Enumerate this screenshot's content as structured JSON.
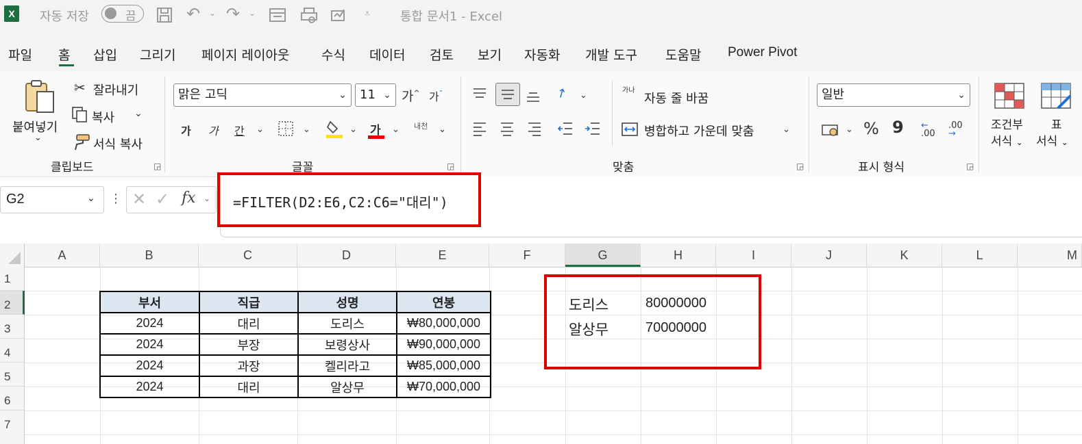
{
  "app": {
    "logo": "X",
    "autosave_label": "자동 저장",
    "autosave_state": "끔",
    "document_title": "통합 문서1  -  Excel"
  },
  "menu": [
    "파일",
    "홈",
    "삽입",
    "그리기",
    "페이지 레이아웃",
    "수식",
    "데이터",
    "검토",
    "보기",
    "자동화",
    "개발 도구",
    "도움말",
    "Power Pivot"
  ],
  "menu_active": "홈",
  "ribbon": {
    "clipboard": {
      "paste": "붙여넣기",
      "cut": "잘라내기",
      "copy": "복사",
      "format_painter": "서식 복사",
      "group": "클립보드"
    },
    "font": {
      "name": "맑은 고딕",
      "size": "11",
      "grow": "가",
      "shrink": "가",
      "bold": "가",
      "italic": "가",
      "underline": "간",
      "color_letter": "가",
      "phonetic": "내천",
      "group": "글꼴"
    },
    "alignment": {
      "wrap": "자동 줄 바꿈",
      "merge": "병합하고 가운데 맞춤",
      "wrap_icon_text": "가나",
      "group": "맞춤"
    },
    "number": {
      "format": "일반",
      "percent": "%",
      "comma": "9",
      "inc_decimal": ".00",
      "dec_decimal": ".00",
      "group": "표시 형식"
    },
    "styles": {
      "conditional_line1": "조건부",
      "conditional_line2": "서식",
      "table_line1": "표",
      "table_line2": "서식"
    }
  },
  "formula_bar": {
    "name_box": "G2",
    "fx": "fx",
    "formula": "=FILTER(D2:E6,C2:C6=\"대리\")"
  },
  "grid": {
    "columns": [
      "A",
      "B",
      "C",
      "D",
      "E",
      "F",
      "G",
      "H",
      "I",
      "J",
      "K",
      "L",
      "M"
    ],
    "rows": [
      "1",
      "2",
      "3",
      "4",
      "5",
      "6",
      "7"
    ],
    "table_headers": [
      "부서",
      "직급",
      "성명",
      "연봉"
    ],
    "table_rows": [
      [
        "2024",
        "대리",
        "도리스",
        "₩80,000,000"
      ],
      [
        "2024",
        "부장",
        "보령상사",
        "₩90,000,000"
      ],
      [
        "2024",
        "과장",
        "켈리라고",
        "₩85,000,000"
      ],
      [
        "2024",
        "대리",
        "알상무",
        "₩70,000,000"
      ]
    ],
    "result": [
      [
        "도리스",
        "80000000"
      ],
      [
        "알상무",
        "70000000"
      ]
    ]
  },
  "colors": {
    "excel_green": "#1d6f42",
    "highlight_red": "#e00000",
    "table_header_fill": "#dce6f1"
  }
}
